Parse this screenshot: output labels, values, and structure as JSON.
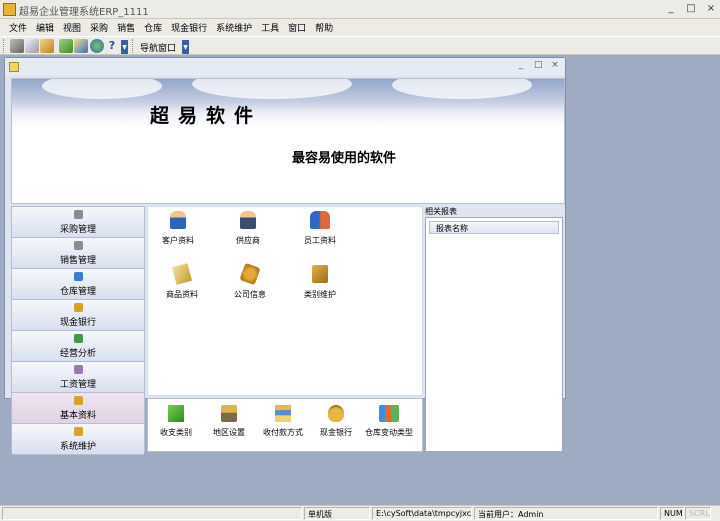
{
  "app": {
    "title": "超易企业管理系统ERP_1111"
  },
  "window_controls": {
    "minimize": "_",
    "maximize": "□",
    "close": "×"
  },
  "menu": [
    {
      "label": "文件"
    },
    {
      "label": "编辑"
    },
    {
      "label": "视图"
    },
    {
      "label": "采购"
    },
    {
      "label": "销售"
    },
    {
      "label": "仓库"
    },
    {
      "label": "现金银行"
    },
    {
      "label": "系统维护"
    },
    {
      "label": "工具"
    },
    {
      "label": "窗口"
    },
    {
      "label": "帮助"
    }
  ],
  "toolbar": {
    "icons": [
      "cut-icon",
      "copy-icon",
      "paste-icon",
      "refresh-icon",
      "edit-icon",
      "globe-icon",
      "help-icon"
    ],
    "nav_window_label": "导航窗口"
  },
  "child_window": {
    "minimize": "_",
    "maximize": "□",
    "close": "×"
  },
  "banner": {
    "title": "超易软件",
    "subtitle": "最容易使用的软件"
  },
  "left_nav": [
    {
      "label": "采购管理",
      "icon": "purchase-icon",
      "color": "#8c8c8c"
    },
    {
      "label": "销售管理",
      "icon": "sales-icon",
      "color": "#8c8c8c"
    },
    {
      "label": "仓库管理",
      "icon": "warehouse-icon",
      "color": "#3b7bd1"
    },
    {
      "label": "现金银行",
      "icon": "cash-bank-icon",
      "color": "#d8a026"
    },
    {
      "label": "经营分析",
      "icon": "analysis-icon",
      "color": "#3f9b46"
    },
    {
      "label": "工资管理",
      "icon": "salary-icon",
      "color": "#9a7bb0"
    },
    {
      "label": "基本资料",
      "icon": "basic-data-icon",
      "color": "#d9a128",
      "active": true
    },
    {
      "label": "系统维护",
      "icon": "system-maintenance-icon",
      "color": "#d9a128"
    }
  ],
  "main_tiles": [
    {
      "label": "客户资料",
      "icon": "customer-icon"
    },
    {
      "label": "供应商",
      "icon": "supplier-icon"
    },
    {
      "label": "员工资料",
      "icon": "employee-icon"
    },
    {
      "label": "商品资料",
      "icon": "product-icon"
    },
    {
      "label": "公司信息",
      "icon": "company-info-icon"
    },
    {
      "label": "类别维护",
      "icon": "category-icon"
    }
  ],
  "bottom_tiles": [
    {
      "label": "收支类别",
      "icon": "income-expense-icon"
    },
    {
      "label": "地区设置",
      "icon": "region-icon"
    },
    {
      "label": "收付款方式",
      "icon": "payment-method-icon"
    },
    {
      "label": "现金银行",
      "icon": "cash-bank-icon"
    },
    {
      "label": "仓库变动类型",
      "icon": "warehouse-change-icon"
    }
  ],
  "reports": {
    "title": "相关报表",
    "column": "报表名称"
  },
  "statusbar": {
    "mode": "单机版",
    "path": "E:\\cySoft\\data\\tmpcyjxc.sys",
    "user": "当前用户：Admin",
    "num": "NUM",
    "scrl": "SCRL"
  }
}
